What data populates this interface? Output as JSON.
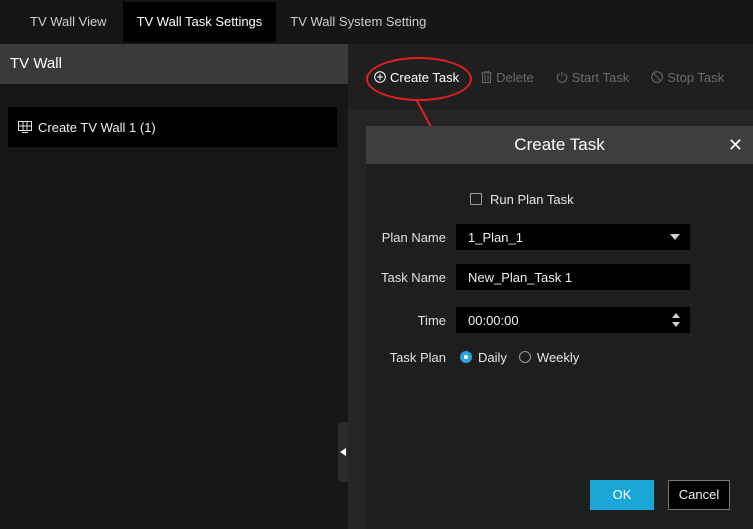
{
  "tabs": [
    {
      "label": "TV Wall View",
      "active": false
    },
    {
      "label": "TV Wall Task Settings",
      "active": true
    },
    {
      "label": "TV Wall System Setting",
      "active": false
    }
  ],
  "left_panel": {
    "title": "TV Wall",
    "items": [
      {
        "label": "Create TV Wall 1 (1)",
        "icon": "tv-wall-icon"
      }
    ]
  },
  "toolbar": {
    "create_task": "Create Task",
    "delete": "Delete",
    "start_task": "Start Task",
    "stop_task": "Stop Task"
  },
  "dialog": {
    "title": "Create Task",
    "close": "✕",
    "run_plan_task": {
      "label": "Run Plan Task",
      "checked": false
    },
    "plan_name": {
      "label": "Plan Name",
      "value": "1_Plan_1"
    },
    "task_name": {
      "label": "Task Name",
      "value": "New_Plan_Task 1"
    },
    "time": {
      "label": "Time",
      "value": "00:00:00"
    },
    "task_plan": {
      "label": "Task Plan",
      "options": [
        "Daily",
        "Weekly"
      ],
      "selected": "Daily"
    },
    "ok": "OK",
    "cancel": "Cancel"
  },
  "colors": {
    "accent": "#1aa6d6",
    "annotation": "#e02020"
  }
}
